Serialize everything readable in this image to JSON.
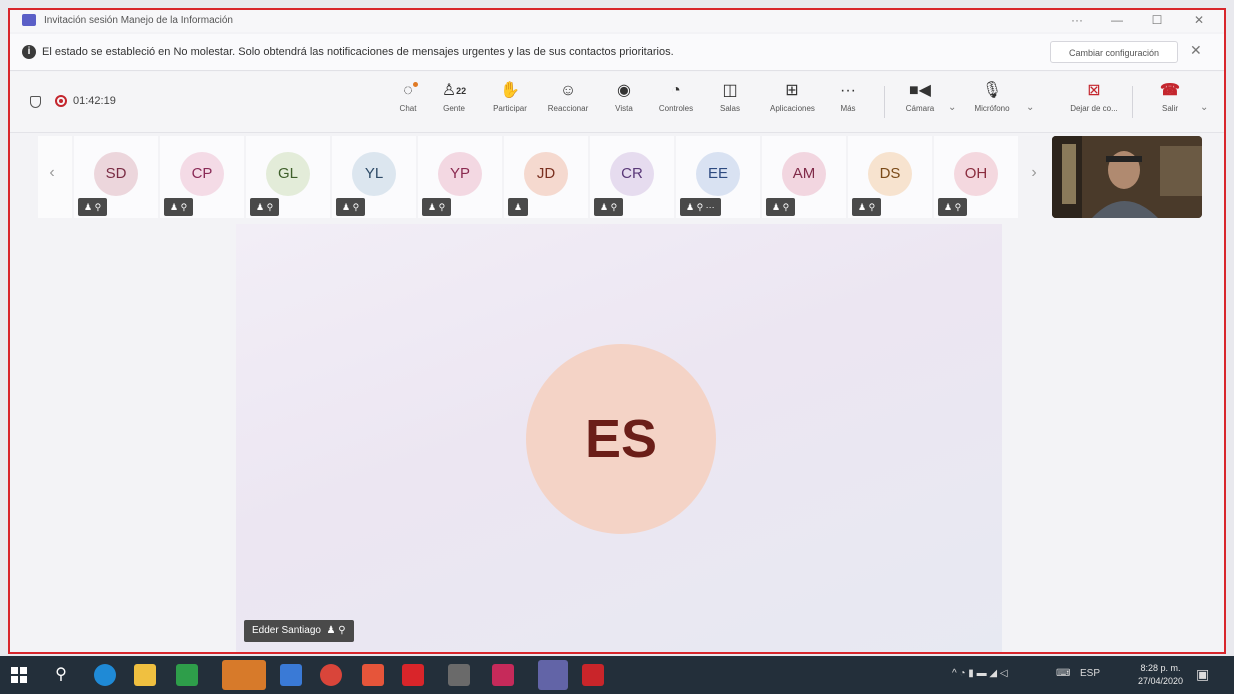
{
  "window": {
    "title": "Invitación sesión Manejo de la Información",
    "controls": [
      "···",
      "—",
      "☐",
      "✕"
    ]
  },
  "banner": {
    "message": "El estado se estableció en No molestar. Solo obtendrá las notificaciones de mensajes urgentes y las de sus contactos prioritarios.",
    "change_button": "Cambiar configuración",
    "close": "✕"
  },
  "toolbar": {
    "timer": "01:42:19",
    "people_count": "22",
    "items": {
      "chat": "Chat",
      "people": "Gente",
      "raise": "Participar",
      "react": "Reaccionar",
      "view": "Vista",
      "controls": "Controles",
      "rooms": "Salas",
      "apps": "Aplicaciones",
      "more": "Más",
      "camera": "Cámara",
      "mic": "Micrófono",
      "share": "Dejar de co...",
      "leave": "Salir"
    }
  },
  "participants": [
    {
      "initials": "SD",
      "bg": "#ecd6dc",
      "fg": "#7a2c44"
    },
    {
      "initials": "CP",
      "bg": "#f4dbe6",
      "fg": "#8a2a56"
    },
    {
      "initials": "GL",
      "bg": "#e3ecd9",
      "fg": "#3e5f2a"
    },
    {
      "initials": "YL",
      "bg": "#dce6ef",
      "fg": "#2d4a66"
    },
    {
      "initials": "YP",
      "bg": "#f3d8e2",
      "fg": "#8a2a50"
    },
    {
      "initials": "JD",
      "bg": "#f5d9cf",
      "fg": "#7a3020"
    },
    {
      "initials": "CR",
      "bg": "#e6dcef",
      "fg": "#5a3878"
    },
    {
      "initials": "EE",
      "bg": "#d9e2f2",
      "fg": "#2d4a80"
    },
    {
      "initials": "AM",
      "bg": "#f2d6e0",
      "fg": "#802a48"
    },
    {
      "initials": "DS",
      "bg": "#f7e3cf",
      "fg": "#7a4a18"
    },
    {
      "initials": "OH",
      "bg": "#f4d8df",
      "fg": "#8a2c3e"
    }
  ],
  "stage": {
    "initials": "ES",
    "name": "Edder Santiago"
  },
  "taskbar": {
    "language": "ESP",
    "time": "8:28 p. m.",
    "date": "27/04/2020"
  }
}
